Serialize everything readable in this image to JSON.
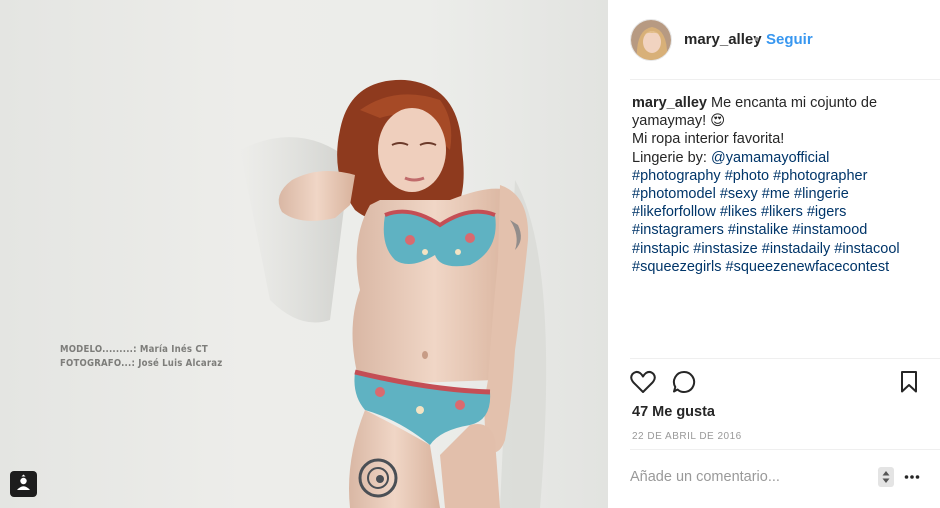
{
  "post": {
    "username": "mary_alley",
    "separator": "•",
    "follow_label": "Seguir",
    "caption": {
      "username": "mary_alley",
      "lines": [
        "Me encanta mi cojunto de",
        "yamaymay!",
        "Mi ropa interior favorita!"
      ],
      "emoji": "😍",
      "lingerie_prefix": "Lingerie by: ",
      "mention": "@yamamayofficial",
      "hashtag_lines": [
        "#photography #photo #photographer",
        "#photomodel #sexy #me #lingerie",
        "#likeforfollow #likes #likers #igers",
        "#instagramers #instalike #instamood",
        "#instapic #instasize #instadaily #instacool",
        "#squeezegirls #squeezenewfacecontest"
      ]
    },
    "likes": "47 Me gusta",
    "date": "22 DE ABRIL DE 2016",
    "comment_placeholder": "Añade un comentario..."
  },
  "photo": {
    "credit_line_1": "MODELO.........: María Inés CT",
    "credit_line_2": "FOTOGRAFO...: José Luis Alcaraz"
  },
  "icons": {
    "like": "heart-outline-icon",
    "comment": "speech-bubble-icon",
    "save": "bookmark-icon",
    "more": "ellipsis-icon",
    "tag": "person-tag-icon"
  },
  "colors": {
    "link": "#003569",
    "follow": "#3897f0",
    "text": "#262626",
    "muted": "#999999"
  }
}
